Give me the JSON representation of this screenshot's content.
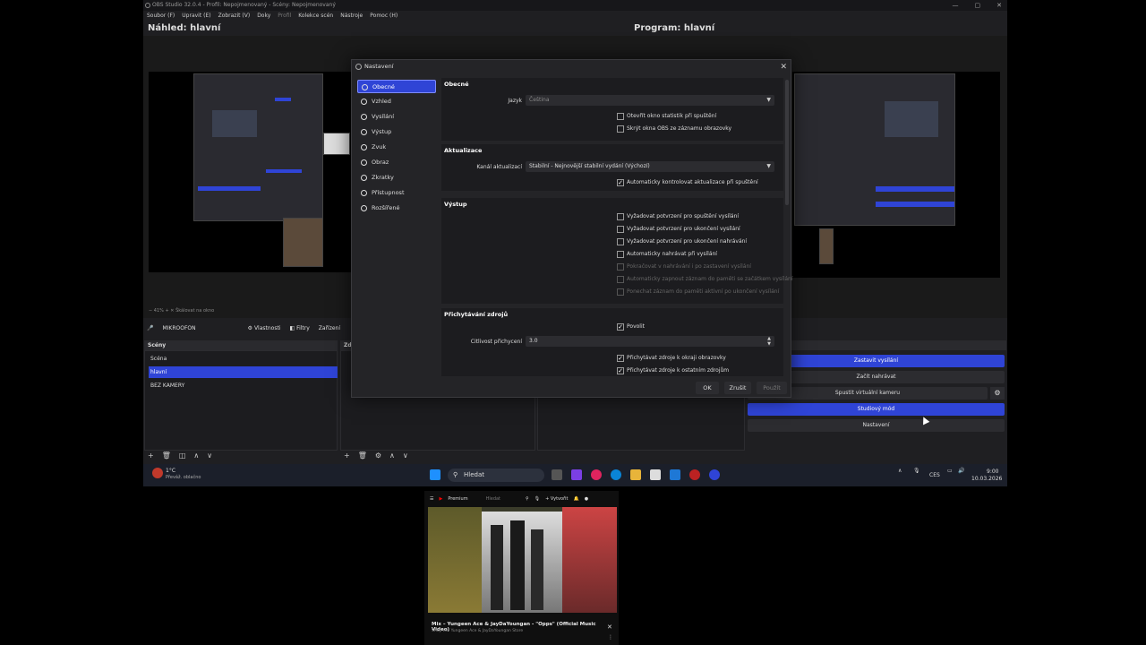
{
  "window": {
    "title": "OBS Studio 32.0.4 - Profil: Nepojmenovaný - Scény: Nepojmenovaný",
    "controls": [
      "—",
      "▢",
      "✕"
    ]
  },
  "menu": [
    "Soubor (F)",
    "Upravit (E)",
    "Zobrazit (V)",
    "Doky",
    "Profil",
    "Kolekce scén",
    "Nástroje",
    "Pomoc (H)"
  ],
  "preview": {
    "left_title": "Náhled: hlavní",
    "right_title": "Program: hlavní"
  },
  "audio": {
    "mic_label": "MIKROOFON",
    "properties_label": "Vlastnosti",
    "filters_label": "Filtry",
    "device_label": "Zařízení"
  },
  "scenes": {
    "header": "Scény",
    "items": [
      {
        "label": "Scéna",
        "selected": false
      },
      {
        "label": "hlavní",
        "selected": true
      },
      {
        "label": "BEZ KAMERY",
        "selected": false
      }
    ]
  },
  "sources_header": "Zd",
  "controls": {
    "stop_stream": "Zastavit vysílání",
    "start_recording": "Začít nahrávat",
    "virtual_cam": "Spustit virtuální kameru",
    "studio_mode": "Studiový mód",
    "settings": "Nastavení"
  },
  "zoom": "41%",
  "scale_label": "Škálovat na okno",
  "settings_dialog": {
    "title": "Nastavení",
    "nav": [
      {
        "label": "Obecné",
        "selected": true
      },
      {
        "label": "Vzhled",
        "selected": false
      },
      {
        "label": "Vysílání",
        "selected": false
      },
      {
        "label": "Výstup",
        "selected": false
      },
      {
        "label": "Zvuk",
        "selected": false
      },
      {
        "label": "Obraz",
        "selected": false
      },
      {
        "label": "Zkratky",
        "selected": false
      },
      {
        "label": "Přístupnost",
        "selected": false
      },
      {
        "label": "Rozšířené",
        "selected": false
      }
    ],
    "general": {
      "title": "Obecné",
      "language_label": "Jazyk",
      "language_value": "Čeština",
      "checks": [
        {
          "label": "Otevřít okno statistik při spuštění",
          "checked": false
        },
        {
          "label": "Skrýt okna OBS ze záznamu obrazovky",
          "checked": false
        }
      ]
    },
    "updates": {
      "title": "Aktualizace",
      "channel_label": "Kanál aktualizací",
      "channel_value": "Stabilní - Nejnovější stabilní vydání (Výchozí)",
      "auto_check": "Automaticky kontrolovat aktualizace při spuštění"
    },
    "output": {
      "title": "Výstup",
      "checks": [
        {
          "label": "Vyžadovat potvrzení pro spuštění vysílání",
          "checked": false,
          "disabled": false
        },
        {
          "label": "Vyžadovat potvrzení pro ukončení vysílání",
          "checked": false,
          "disabled": false
        },
        {
          "label": "Vyžadovat potvrzení pro ukončení nahrávání",
          "checked": false,
          "disabled": false
        },
        {
          "label": "Automaticky nahrávat při vysílání",
          "checked": false,
          "disabled": false
        },
        {
          "label": "Pokračovat v nahrávání i po zastavení vysílání",
          "checked": false,
          "disabled": true
        },
        {
          "label": "Automaticky zapnout záznam do paměti se začátkem vysílání",
          "checked": false,
          "disabled": true
        },
        {
          "label": "Ponechat záznam do paměti aktivní po ukončení vysílání",
          "checked": false,
          "disabled": true
        }
      ]
    },
    "snapping": {
      "title": "Přichytávání zdrojů",
      "enable": "Povolit",
      "sensitivity_label": "Citlivost přichycení",
      "sensitivity_value": "3.0",
      "checks": [
        {
          "label": "Přichytávat zdroje k okraji obrazovky",
          "checked": true
        },
        {
          "label": "Přichytávat zdroje k ostatním zdrojům",
          "checked": true
        }
      ]
    },
    "buttons": {
      "ok": "OK",
      "cancel": "Zrušit",
      "apply": "Použít"
    }
  },
  "taskbar": {
    "weather_temp": "1°C",
    "weather_desc": "Převáž. oblačno",
    "search_placeholder": "Hledat",
    "lang": "CES",
    "time": "9:00",
    "date": "10.03.2026"
  },
  "youtube": {
    "brand": "Premium",
    "search": "Hledat",
    "create": "Vytvořit",
    "title": "Mix – Yungeen Ace & JayDaYoungan - \"Opps\" (Official Music Video)",
    "subtitle": "Shop the Yungeen Ace & JayDaYoungan Store"
  },
  "colors": {
    "accent": "#2f44d6",
    "background": "#1f1f22"
  }
}
